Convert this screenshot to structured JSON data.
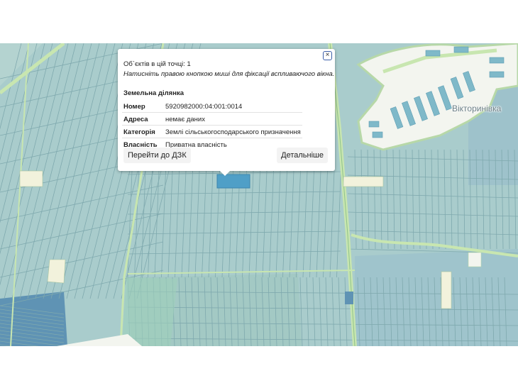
{
  "map": {
    "place_label": "Вікторинівка",
    "colors": {
      "parcel_fill": "#a9cccc",
      "parcel_line": "#7fa9ae",
      "selected_parcel": "#4f9fc7",
      "road": "#c8e6b0",
      "settlement": "#f3f5ef",
      "unclassified": "#f2f2dc"
    }
  },
  "popup": {
    "count_text": "Об`єктів в цій точці: 1",
    "hint_text": "Натисніть правою кнопкою миші для фіксації вспливаючого вікна.",
    "close_label": "×",
    "section_title": "Земельна ділянка",
    "rows": [
      {
        "key": "Номер",
        "value": "5920982000:04:001:0014"
      },
      {
        "key": "Адреса",
        "value": "немає даних"
      },
      {
        "key": "Категорія",
        "value": "Землі сільськогосподарського призначення"
      },
      {
        "key": "Власність",
        "value": "Приватна власність"
      }
    ],
    "goto_button": "Перейти до ДЗК",
    "details_button": "Детальніше"
  }
}
